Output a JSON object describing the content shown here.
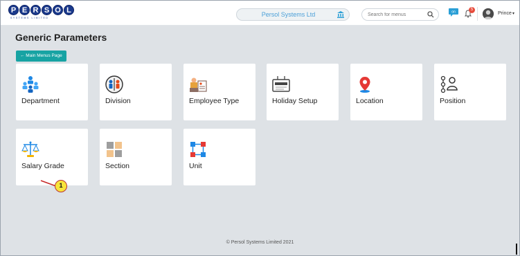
{
  "header": {
    "logo_text": "PERSOL",
    "logo_subtext": "SYSTEMS LIMITED",
    "company_name": "Persol Systems Ltd",
    "search_placeholder": "Search for menus",
    "chat_badge": "on",
    "notification_count": "5",
    "user_name": "Prince",
    "user_caret": "▾"
  },
  "main": {
    "title": "Generic Parameters",
    "back_button_label": "← Main Menus Page",
    "cards": [
      {
        "label": "Department",
        "icon": "department-icon"
      },
      {
        "label": "Division",
        "icon": "division-icon"
      },
      {
        "label": "Employee Type",
        "icon": "employee-type-icon"
      },
      {
        "label": "Holiday Setup",
        "icon": "holiday-setup-icon"
      },
      {
        "label": "Location",
        "icon": "location-pin-icon"
      },
      {
        "label": "Position",
        "icon": "position-icon"
      },
      {
        "label": "Salary Grade",
        "icon": "scales-icon"
      },
      {
        "label": "Section",
        "icon": "section-icon"
      },
      {
        "label": "Unit",
        "icon": "unit-icon"
      }
    ],
    "footer": "© Persol Systems Limited 2021"
  },
  "annotation": {
    "callout_number": "1"
  },
  "colors": {
    "brand_blue": "#1b3a8c",
    "accent_teal": "#17a3a3",
    "page_bg": "#dee2e6",
    "badge_red": "#e74c3c"
  }
}
